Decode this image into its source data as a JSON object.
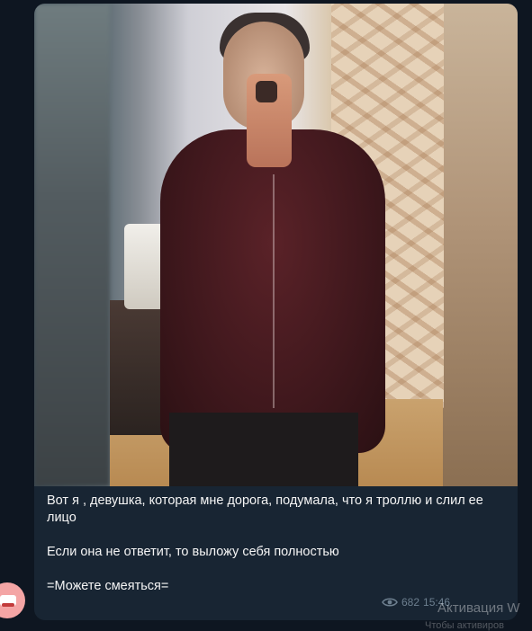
{
  "message": {
    "caption": [
      "Вот я , девушка, которая мне дорога, подумала, что я троллю и слил ее лицо",
      "Если она не ответит, то выложу себя полностью",
      "=Можете смеяться="
    ],
    "views": "682",
    "time": "15:46",
    "views_icon": "eye-icon"
  },
  "watermark": {
    "title": "Активация W",
    "subtitle": "Чтобы активиров"
  },
  "colors": {
    "background": "#0e1621",
    "bubble": "#182533",
    "meta_text": "#6d7f8f"
  }
}
